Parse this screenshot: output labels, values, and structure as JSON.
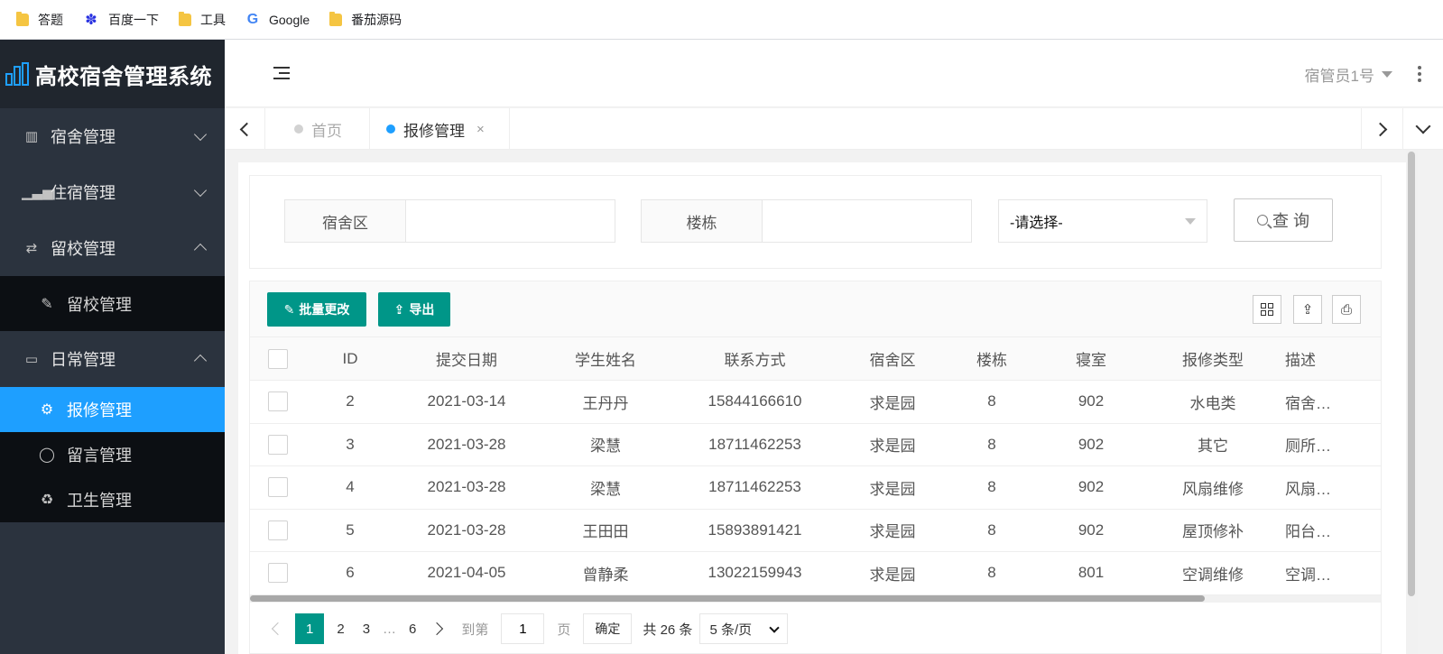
{
  "bookmarks": [
    {
      "label": "答题",
      "icon": "folder-icon"
    },
    {
      "label": "百度一下",
      "icon": "baidu-icon"
    },
    {
      "label": "工具",
      "icon": "folder-icon"
    },
    {
      "label": "Google",
      "icon": "google-icon"
    },
    {
      "label": "番茄源码",
      "icon": "folder-icon"
    }
  ],
  "app": {
    "title": "高校宿舍管理系统"
  },
  "sidebar": {
    "menus": [
      {
        "label": "宿舍管理",
        "icon": "building-icon",
        "expanded": false
      },
      {
        "label": "住宿管理",
        "icon": "signal-icon",
        "expanded": false
      },
      {
        "label": "留校管理",
        "icon": "transfer-icon",
        "expanded": true
      },
      {
        "label": "日常管理",
        "icon": "laptop-icon",
        "expanded": true
      }
    ],
    "stay_sub": [
      {
        "label": "留校管理",
        "icon": "edit-icon"
      }
    ],
    "daily_sub": [
      {
        "label": "报修管理",
        "icon": "gear-icon",
        "active": true
      },
      {
        "label": "留言管理",
        "icon": "chat-icon"
      },
      {
        "label": "卫生管理",
        "icon": "recycle-icon"
      }
    ]
  },
  "header": {
    "user": "宿管员1号"
  },
  "tabs": {
    "home": "首页",
    "current": "报修管理",
    "close": "×"
  },
  "search": {
    "area_label": "宿舍区",
    "area_value": "",
    "building_label": "楼栋",
    "building_value": "",
    "select_value": "-请选择-",
    "query_label": "查 询"
  },
  "toolbar": {
    "batch_label": "批量更改",
    "export_label": "导出"
  },
  "table": {
    "columns": [
      "ID",
      "提交日期",
      "学生姓名",
      "联系方式",
      "宿舍区",
      "楼栋",
      "寝室",
      "报修类型",
      "描述"
    ],
    "rows": [
      [
        "2",
        "2021-03-14",
        "王丹丹",
        "15844166610",
        "求是园",
        "8",
        "902",
        "水电类",
        "宿舍…"
      ],
      [
        "3",
        "2021-03-28",
        "梁慧",
        "18711462253",
        "求是园",
        "8",
        "902",
        "其它",
        "厕所…"
      ],
      [
        "4",
        "2021-03-28",
        "梁慧",
        "18711462253",
        "求是园",
        "8",
        "902",
        "风扇维修",
        "风扇…"
      ],
      [
        "5",
        "2021-03-28",
        "王田田",
        "15893891421",
        "求是园",
        "8",
        "902",
        "屋顶修补",
        "阳台…"
      ],
      [
        "6",
        "2021-04-05",
        "曾静柔",
        "13022159943",
        "求是园",
        "8",
        "801",
        "空调维修",
        "空调…"
      ]
    ]
  },
  "pager": {
    "pages": [
      "1",
      "2",
      "3"
    ],
    "ellipsis": "…",
    "last": "6",
    "goto_label": "到第",
    "goto_value": "1",
    "page_unit": "页",
    "confirm": "确定",
    "total": "共 26 条",
    "per_page": "5 条/页"
  },
  "colors": {
    "accent": "#009688",
    "active_nav": "#1e9fff",
    "sidebar": "#2b333e"
  }
}
